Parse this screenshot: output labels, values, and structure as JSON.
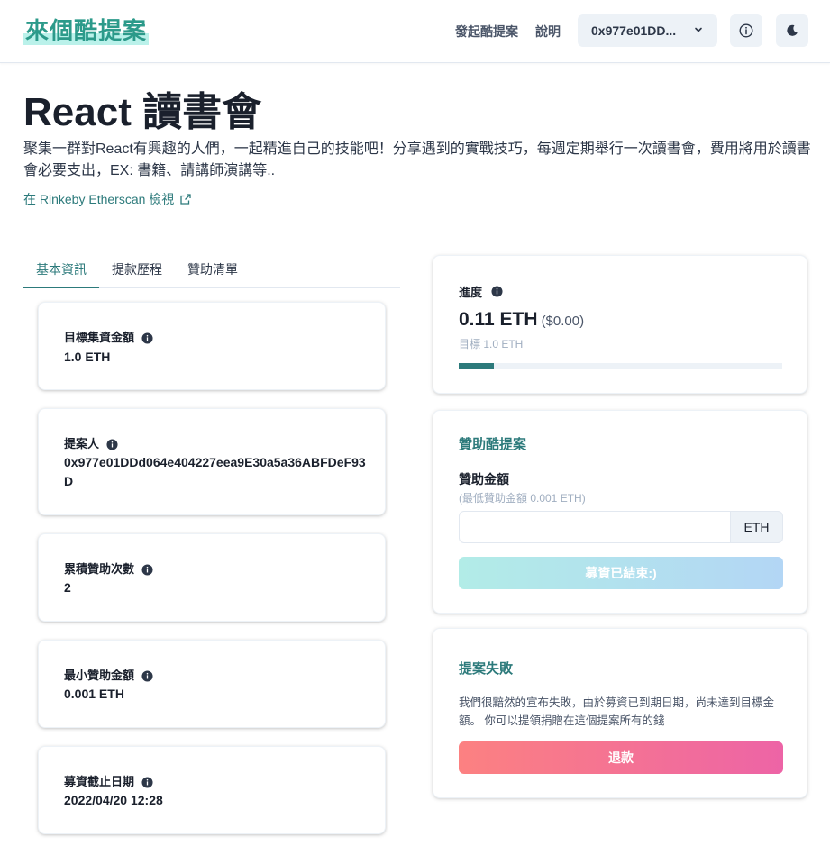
{
  "header": {
    "logo": "來個酷提案",
    "nav_propose": "發起酷提案",
    "nav_help": "說明",
    "wallet_address": "0x977e01DD...",
    "icons": {
      "wallet_chevron": "chevron-down-icon",
      "info": "info-circle-icon",
      "theme": "moon-icon"
    }
  },
  "project": {
    "title": "React 讀書會",
    "description": "聚集一群對React有興趣的人們，一起精進自己的技能吧！分享遇到的實戰技巧，每週定期舉行一次讀書會，費用將用於讀書會必要支出，EX: 書籍、請講師演講等..",
    "etherscan_link": "在 Rinkeby Etherscan 檢視"
  },
  "tabs": [
    {
      "label": "基本資訊",
      "active": true
    },
    {
      "label": "提款歷程",
      "active": false
    },
    {
      "label": "贊助清單",
      "active": false
    }
  ],
  "info_cards": [
    {
      "label": "目標集資金額",
      "value": "1.0 ETH"
    },
    {
      "label": "提案人",
      "value": "0x977e01DDd064e404227eea9E30a5a36ABFDeF93D"
    },
    {
      "label": "累積贊助次數",
      "value": "2"
    },
    {
      "label": "最小贊助金額",
      "value": "0.001 ETH"
    },
    {
      "label": "募資截止日期",
      "value": "2022/04/20 12:28"
    }
  ],
  "progress": {
    "label": "進度",
    "amount": "0.11 ETH",
    "usd": "($0.00)",
    "goal": "目標 1.0 ETH",
    "fraction": 0.11
  },
  "sponsor": {
    "heading": "贊助酷提案",
    "amount_label": "贊助金額",
    "hint": "(最低贊助金額 0.001 ETH)",
    "input_value": "",
    "unit": "ETH",
    "button": "募資已結束:)"
  },
  "failure": {
    "heading": "提案失敗",
    "message": "我們很黯然的宣布失敗，由於募資已到期日期，尚未達到目標金額。 你可以提領捐贈在這個提案所有的錢",
    "refund_button": "退款"
  },
  "colors": {
    "accent": "#2c7a7b",
    "logo": "#2c9a8a",
    "refund_start": "#fc8181",
    "refund_end": "#ed64a6"
  }
}
